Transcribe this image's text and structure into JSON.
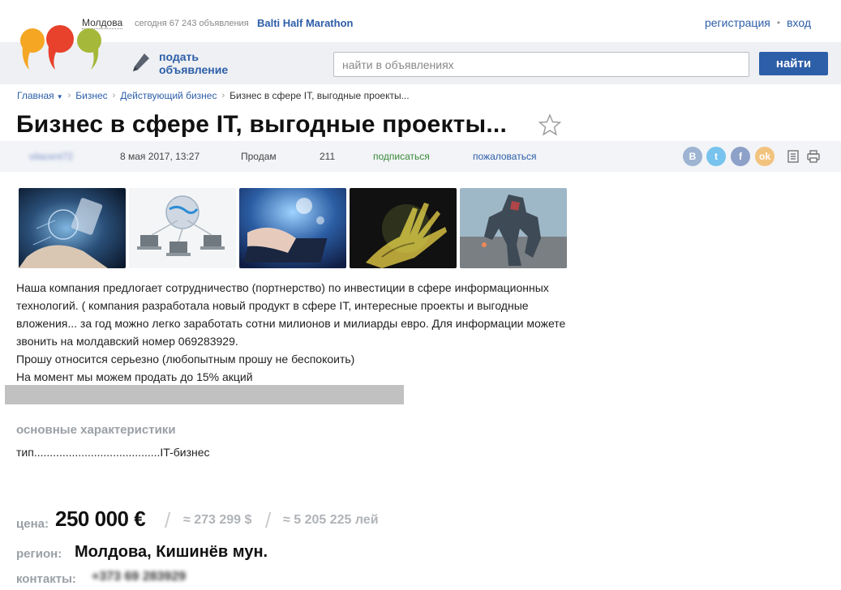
{
  "top": {
    "region": "Молдова",
    "today": "сегодня 67 243 объявления",
    "promo": "Balti Half Marathon",
    "register": "регистрация",
    "login": "вход"
  },
  "header": {
    "post_ad": "подать объявление",
    "search_placeholder": "найти в объявлениях",
    "search_button": "найти"
  },
  "breadcrumb": [
    "Главная",
    "Бизнес",
    "Действующий бизнес",
    "Бизнес в сфере IT, выгодные проекты..."
  ],
  "title": "Бизнес в сфере IT, выгодные проекты...",
  "meta": {
    "user": "vilacent72",
    "date": "8 мая 2017, 13:27",
    "type": "Продам",
    "views": "211",
    "subscribe": "подписаться",
    "report": "пожаловаться"
  },
  "social": [
    "В",
    "t",
    "f",
    "ok"
  ],
  "description": [
    "Наша компания предлогает сотрудничество (портнерство) по инвестиции в сфере информационных",
    "технологий. ( компания разработала новый продукт в сфере IT, интересные проекты и выгодные",
    "вложения... за год можно легко заработать сотни милионов и милиарды евро.  Для информации можете",
    "звонить на молдавский номер 069283929.",
    "Прошу относится серьезно (любопытным прошу не беспокоить)",
    "На момент мы можем продать до 15% акций"
  ],
  "characteristics": {
    "title": "основные характеристики",
    "rows": [
      {
        "label": "тип",
        "dots": "........................................",
        "value": "IT-бизнес"
      }
    ]
  },
  "price": {
    "label": "цена:",
    "main": "250 000 €",
    "usd": "≈ 273 299 $",
    "lei": "≈ 5 205 225 лей"
  },
  "region": {
    "label": "регион:",
    "value": "Молдова, Кишинёв мун."
  },
  "contacts": {
    "label": "контакты:",
    "value": "+373 69 283929"
  },
  "colors": {
    "accent": "#2d5ea8",
    "subscribe": "#3a8a3a",
    "header_bg": "#eef0f3"
  }
}
